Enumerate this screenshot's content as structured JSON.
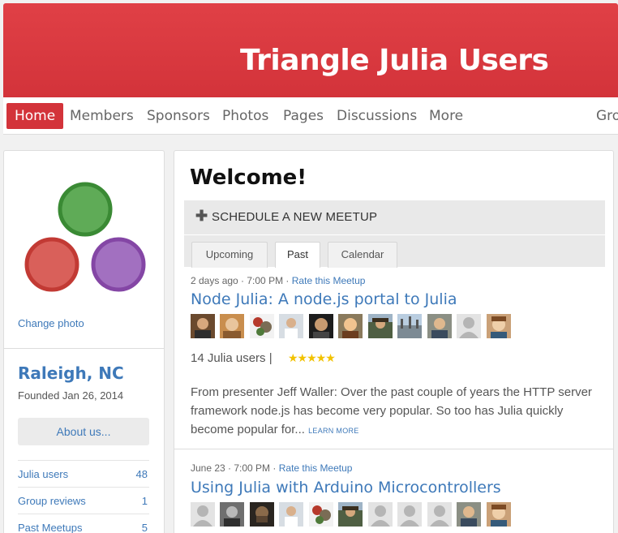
{
  "banner": {
    "title": "Triangle Julia Users"
  },
  "nav": {
    "items": [
      "Home",
      "Members",
      "Sponsors",
      "Photos",
      "Pages",
      "Discussions",
      "More",
      "Gro"
    ]
  },
  "sidebar": {
    "change_photo": "Change photo",
    "city": "Raleigh, NC",
    "founded": "Founded Jan 26, 2014",
    "about_btn": "About us...",
    "stats": [
      {
        "label": "Julia users",
        "count": "48"
      },
      {
        "label": "Group reviews",
        "count": "1"
      },
      {
        "label": "Past Meetups",
        "count": "5"
      }
    ],
    "logo_colors": {
      "top": "#5fab57",
      "left": "#d9605a",
      "right": "#a270c0"
    }
  },
  "main": {
    "welcome": "Welcome!",
    "schedule": "SCHEDULE A NEW MEETUP",
    "tabs": [
      "Upcoming",
      "Past",
      "Calendar"
    ],
    "active_tab": "Past"
  },
  "events": [
    {
      "date": "2 days ago · 7:00 PM",
      "rate": "Rate this Meetup",
      "title": "Node Julia: A node.js portal to Julia",
      "attendees": "14 Julia users",
      "rating_stars": 5,
      "stars_text": "★★★★★",
      "description": "From presenter Jeff Waller: Over the past couple of years the HTTP server framework node.js has become very popular. So too has Julia quickly become popular for...",
      "learn_more": "LEARN MORE"
    },
    {
      "date": "June 23 · 7:00 PM",
      "rate": "Rate this Meetup",
      "title": "Using Julia with Arduino Microcontrollers"
    }
  ],
  "colors": {
    "brand_red": "#d3333a",
    "link_blue": "#3e79b9"
  }
}
